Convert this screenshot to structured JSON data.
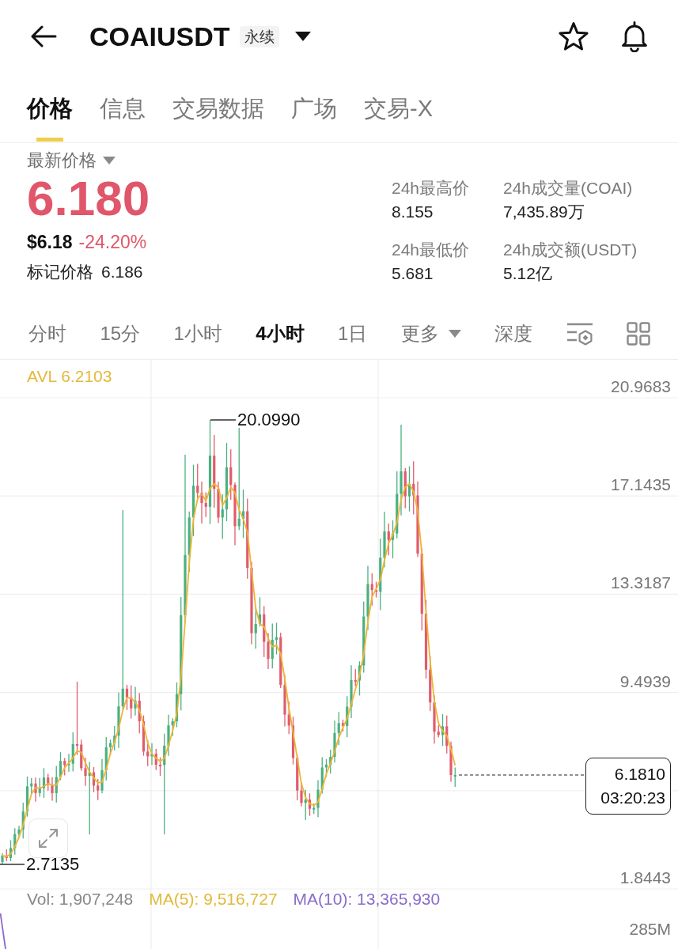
{
  "header": {
    "title": "COAIUSDT",
    "badge": "永续"
  },
  "tabs": [
    {
      "label": "价格",
      "selected": true
    },
    {
      "label": "信息",
      "selected": false
    },
    {
      "label": "交易数据",
      "selected": false
    },
    {
      "label": "广场",
      "selected": false
    },
    {
      "label": "交易-X",
      "selected": false
    }
  ],
  "ticker": {
    "label": "最新价格",
    "last_price": "6.180",
    "usd_price": "$6.18",
    "change": "-24.20%",
    "mark_label": "标记价格",
    "mark_price": "6.186"
  },
  "stats": [
    {
      "label": "24h最高价",
      "value": "8.155"
    },
    {
      "label": "24h成交量(COAI)",
      "value": "7,435.89万"
    },
    {
      "label": "24h最低价",
      "value": "5.681"
    },
    {
      "label": "24h成交额(USDT)",
      "value": "5.12亿"
    }
  ],
  "intervals": [
    {
      "label": "分时",
      "selected": false,
      "kind": "tab"
    },
    {
      "label": "15分",
      "selected": false,
      "kind": "tab"
    },
    {
      "label": "1小时",
      "selected": false,
      "kind": "tab"
    },
    {
      "label": "4小时",
      "selected": true,
      "kind": "tab"
    },
    {
      "label": "1日",
      "selected": false,
      "kind": "tab"
    },
    {
      "label": "更多",
      "selected": false,
      "kind": "menu"
    },
    {
      "label": "深度",
      "selected": false,
      "kind": "tab"
    }
  ],
  "chart": {
    "avl": "AVL 6.2103",
    "y_axis_labels": [
      "20.9683",
      "17.1435",
      "13.3187",
      "9.4939",
      "1.8443"
    ],
    "high_label": "20.0990",
    "low_label": "2.7135",
    "last_price": "6.1810",
    "countdown": "03:20:23"
  },
  "volume": {
    "vol": "Vol: 1,907,248",
    "ma5": "MA(5): 9,516,727",
    "ma10": "MA(10): 13,365,930",
    "axis_label": "285M"
  }
}
